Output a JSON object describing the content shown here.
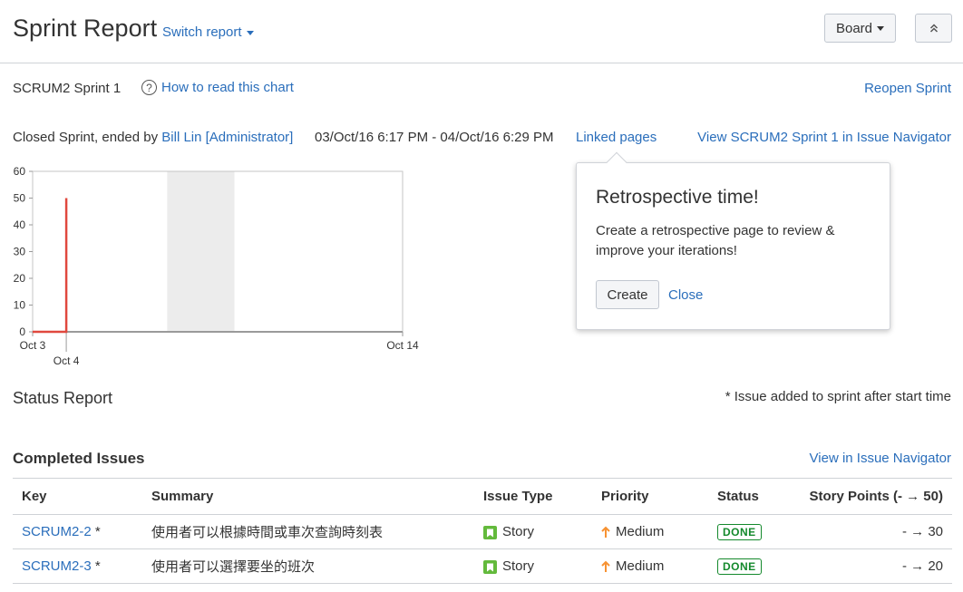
{
  "header": {
    "title": "Sprint Report",
    "switch_report": "Switch report",
    "board_button": "Board"
  },
  "sprint": {
    "name": "SCRUM2 Sprint 1",
    "help_link": "How to read this chart",
    "reopen": "Reopen Sprint",
    "closed_prefix": "Closed Sprint, ended by",
    "ended_by": "Bill Lin [Administrator]",
    "date_range": "03/Oct/16 6:17 PM - 04/Oct/16 6:29 PM",
    "linked_pages": "Linked pages",
    "view_in_navigator": "View SCRUM2 Sprint 1 in Issue Navigator"
  },
  "chart_data": {
    "type": "line",
    "ylim": [
      0,
      60
    ],
    "y_ticks": [
      "0",
      "10",
      "20",
      "30",
      "40",
      "50",
      "60"
    ],
    "x_ticks": [
      "Oct 3",
      "Oct 4",
      "Oct 14"
    ],
    "x_range_days": [
      3,
      14
    ],
    "series": [
      {
        "color": "#e0483e",
        "points": [
          [
            3,
            0
          ],
          [
            4,
            0
          ],
          [
            4,
            50
          ]
        ]
      }
    ],
    "non_working_band_days": [
      7,
      9
    ]
  },
  "popup": {
    "title": "Retrospective time!",
    "text": "Create a retrospective page to review & improve your iterations!",
    "create": "Create",
    "close": "Close"
  },
  "status": {
    "title": "Status Report",
    "note": "* Issue added to sprint after start time"
  },
  "completed": {
    "title": "Completed Issues",
    "view_link": "View in Issue Navigator",
    "columns": [
      "Key",
      "Summary",
      "Issue Type",
      "Priority",
      "Status",
      "Story Points (- → 50)"
    ],
    "rows": [
      {
        "key": "SCRUM2-2",
        "marker": "*",
        "summary": "使用者可以根據時間或車次查詢時刻表",
        "type": "Story",
        "priority": "Medium",
        "status": "DONE",
        "points": "- → 30"
      },
      {
        "key": "SCRUM2-3",
        "marker": "*",
        "summary": "使用者可以選擇要坐的班次",
        "type": "Story",
        "priority": "Medium",
        "status": "DONE",
        "points": "- → 20"
      }
    ]
  },
  "colors": {
    "link": "#2a6ebb",
    "story": "#63ba3c",
    "priority_medium": "#f79232",
    "done": "#14892c",
    "burndown_line": "#e0483e"
  }
}
